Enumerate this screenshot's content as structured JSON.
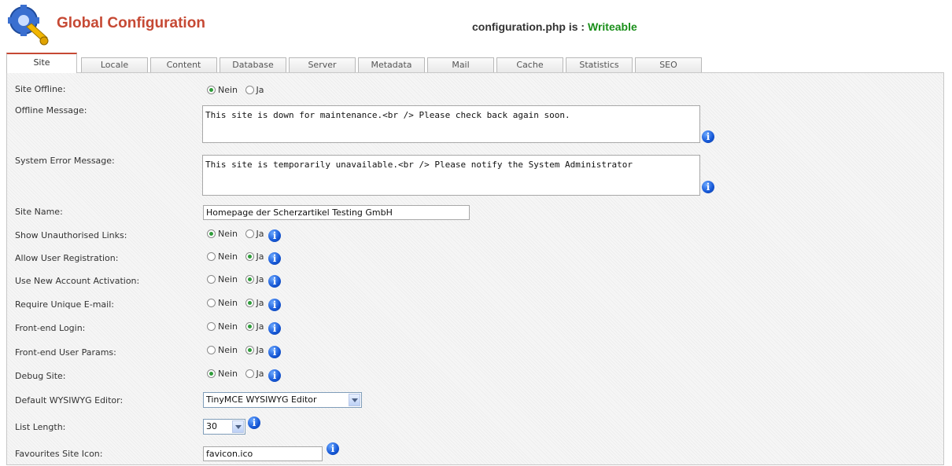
{
  "header": {
    "title": "Global Configuration",
    "status_prefix": "configuration.php is : ",
    "status_value": "Writeable"
  },
  "tabs": [
    "Site",
    "Locale",
    "Content",
    "Database",
    "Server",
    "Metadata",
    "Mail",
    "Cache",
    "Statistics",
    "SEO"
  ],
  "active_tab": "Site",
  "icons": {
    "logo": "config-tools-icon",
    "info": "info-icon"
  },
  "radio_options": {
    "no": "Nein",
    "yes": "Ja"
  },
  "fields": {
    "site_offline": {
      "label": "Site Offline:",
      "value": "Nein"
    },
    "offline_message": {
      "label": "Offline Message:",
      "value": "This site is down for maintenance.<br /> Please check back again soon."
    },
    "system_error_message": {
      "label": "System Error Message:",
      "value": "This site is temporarily unavailable.<br /> Please notify the System Administrator"
    },
    "site_name": {
      "label": "Site Name:",
      "value": "Homepage der Scherzartikel Testing GmbH"
    },
    "show_unauthorised_links": {
      "label": "Show Unauthorised Links:",
      "value": "Nein"
    },
    "allow_user_registration": {
      "label": "Allow User Registration:",
      "value": "Ja"
    },
    "use_new_account_activation": {
      "label": "Use New Account Activation:",
      "value": "Ja"
    },
    "require_unique_email": {
      "label": "Require Unique E-mail:",
      "value": "Ja"
    },
    "frontend_login": {
      "label": "Front-end Login:",
      "value": "Ja"
    },
    "frontend_user_params": {
      "label": "Front-end User Params:",
      "value": "Ja"
    },
    "debug_site": {
      "label": "Debug Site:",
      "value": "Nein"
    },
    "default_editor": {
      "label": "Default WYSIWYG Editor:",
      "value": "TinyMCE WYSIWYG Editor"
    },
    "list_length": {
      "label": "List Length:",
      "value": "30"
    },
    "favourites_icon": {
      "label": "Favourites Site Icon:",
      "value": "favicon.ico"
    }
  },
  "colors": {
    "title": "#c64934",
    "writeable": "#1a8f1a",
    "radio_selected": "#2f9c3a",
    "info_icon": "#1557d6"
  }
}
